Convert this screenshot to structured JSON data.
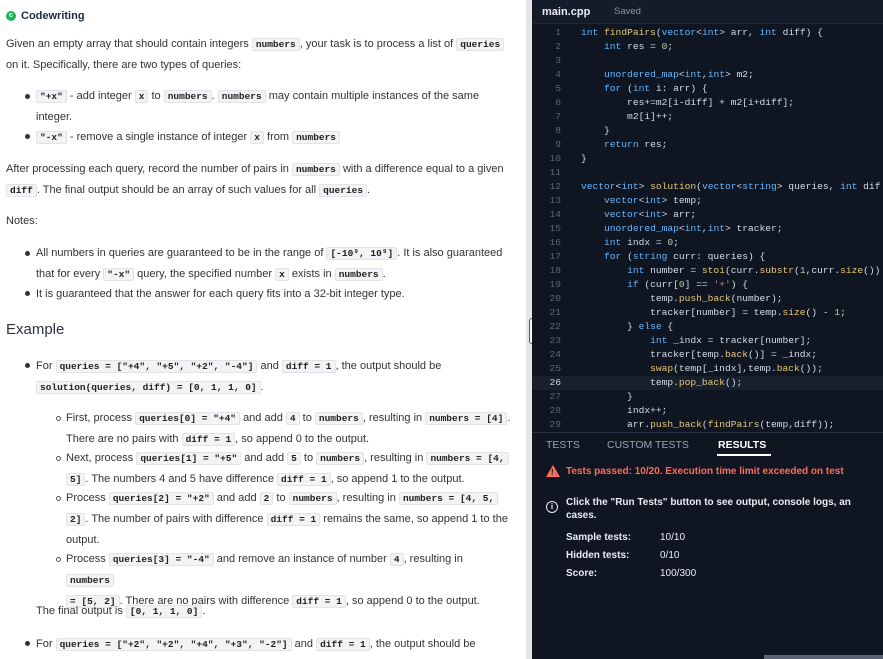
{
  "brand": {
    "name": "Codewriting",
    "icon": "codesignal-icon"
  },
  "problem": {
    "intro_1": "Given an empty array that should contain integers",
    "intro_numbers": "numbers",
    "intro_2": ", your task is to process a list of",
    "intro_queries": "queries",
    "intro_3": "on it. Specifically, there are two types of queries:",
    "q1_code": "\"+x\"",
    "q1_t1": "- add integer",
    "q1_x": "x",
    "q1_t2": "to",
    "q1_numbers": "numbers",
    "q1_t3": ".",
    "q1_numbers2": "numbers",
    "q1_t4": "may contain multiple instances of the same",
    "q1_t5": "integer.",
    "q2_code": "\"-x\"",
    "q2_t1": "- remove a single instance of integer",
    "q2_x": "x",
    "q2_t2": "from",
    "q2_numbers": "numbers",
    "after_1": "After processing each query, record the number of pairs in",
    "after_numbers": "numbers",
    "after_2": "with a difference equal to a given",
    "after_diff": "diff",
    "after_3": ". The final output should be an array of such values for all",
    "after_queries": "queries",
    "after_4": ".",
    "notes_label": "Notes",
    "notes_colon": ":",
    "note1_t1": "All numbers in queries are guaranteed to be in the range of",
    "note1_range": "[-10⁹, 10⁹]",
    "note1_t2": ". It is also guaranteed",
    "note1_t3": "that for every",
    "note1_code": "\"-x\"",
    "note1_t4": "query, the specified number",
    "note1_x": "x",
    "note1_t5": "exists in",
    "note1_numbers": "numbers",
    "note1_t6": ".",
    "note2": "It is guaranteed that the answer for each query fits into a 32-bit integer type.",
    "example_heading": "Example",
    "ex1_t1": "For",
    "ex1_queries": "queries = [\"+4\", \"+5\", \"+2\", \"-4\"]",
    "ex1_t2": "and",
    "ex1_diff": "diff = 1",
    "ex1_t3": ", the output should be",
    "ex1_solution": "solution(queries, diff) = [0, 1, 1, 0]",
    "ex1_t4": ".",
    "s1_t1": "First, process",
    "s1_q": "queries[0] = \"+4\"",
    "s1_t2": "and add",
    "s1_n": "4",
    "s1_t3": "to",
    "s1_numbers": "numbers",
    "s1_t4": ", resulting in",
    "s1_res": "numbers = [4]",
    "s1_t5": ".",
    "s1_t6": "There are no pairs with",
    "s1_diff": "diff = 1",
    "s1_t7": ", so append 0 to the output.",
    "s2_t1": "Next, process",
    "s2_q": "queries[1] = \"+5\"",
    "s2_t2": "and add",
    "s2_n": "5",
    "s2_t3": "to",
    "s2_numbers": "numbers",
    "s2_t4": ", resulting in",
    "s2_res_a": "numbers = [4,",
    "s2_res_b": "5]",
    "s2_t5": ". The numbers 4 and 5 have difference",
    "s2_diff": "diff = 1",
    "s2_t6": ", so append 1 to the output.",
    "s3_t1": "Process",
    "s3_q": "queries[2] = \"+2\"",
    "s3_t2": "and add",
    "s3_n": "2",
    "s3_t3": "to",
    "s3_numbers": "numbers",
    "s3_t4": ", resulting in",
    "s3_res_a": "numbers = [4, 5,",
    "s3_res_b": "2]",
    "s3_t5": ". The number of pairs with difference",
    "s3_diff": "diff = 1",
    "s3_t6": "remains the same, so append 1 to the",
    "s3_t7": "output.",
    "s4_t1": "Process",
    "s4_q": "queries[3] = \"-4\"",
    "s4_t2": "and remove an instance of number",
    "s4_n": "4",
    "s4_t3": ", resulting in",
    "s4_res_a": "numbers",
    "s4_res_b": "= [5, 2]",
    "s4_t4": ". There are no pairs with difference",
    "s4_diff": "diff = 1",
    "s4_t5": ", so append 0 to the output.",
    "final_t1": "The final output is",
    "final_code": "[0, 1, 1, 0]",
    "final_t2": ".",
    "ex2_t1": "For",
    "ex2_queries": "queries = [\"+2\", \"+2\", \"+4\", \"+3\", \"-2\"]",
    "ex2_t2": "and",
    "ex2_diff": "diff = 1",
    "ex2_t3": ", the output should be"
  },
  "editor": {
    "file_tab": "main.cpp",
    "saved_label": "Saved",
    "lines": [
      {
        "n": "1",
        "t": "int findPairs(vector<int> arr, int diff) {"
      },
      {
        "n": "2",
        "t": "    int res = 0;"
      },
      {
        "n": "3",
        "t": ""
      },
      {
        "n": "4",
        "t": "    unordered_map<int,int> m2;"
      },
      {
        "n": "5",
        "t": "    for (int i: arr) {"
      },
      {
        "n": "6",
        "t": "        res+=m2[i-diff] + m2[i+diff];"
      },
      {
        "n": "7",
        "t": "        m2[i]++;"
      },
      {
        "n": "8",
        "t": "    }"
      },
      {
        "n": "9",
        "t": "    return res;"
      },
      {
        "n": "10",
        "t": "}"
      },
      {
        "n": "11",
        "t": ""
      },
      {
        "n": "12",
        "t": "vector<int> solution(vector<string> queries, int dif"
      },
      {
        "n": "13",
        "t": "    vector<int> temp;"
      },
      {
        "n": "14",
        "t": "    vector<int> arr;"
      },
      {
        "n": "15",
        "t": "    unordered_map<int,int> tracker;"
      },
      {
        "n": "16",
        "t": "    int indx = 0;"
      },
      {
        "n": "17",
        "t": "    for (string curr: queries) {"
      },
      {
        "n": "18",
        "t": "        int number = stoi(curr.substr(1,curr.size())"
      },
      {
        "n": "19",
        "t": "        if (curr[0] == '+') {"
      },
      {
        "n": "20",
        "t": "            temp.push_back(number);"
      },
      {
        "n": "21",
        "t": "            tracker[number] = temp.size() - 1;"
      },
      {
        "n": "22",
        "t": "        } else {"
      },
      {
        "n": "23",
        "t": "            int _indx = tracker[number];"
      },
      {
        "n": "24",
        "t": "            tracker[temp.back()] = _indx;"
      },
      {
        "n": "25",
        "t": "            swap(temp[_indx],temp.back());"
      },
      {
        "n": "26",
        "t": "            temp.pop_back();"
      },
      {
        "n": "27",
        "t": "        }"
      },
      {
        "n": "28",
        "t": "        indx++;"
      },
      {
        "n": "29",
        "t": "        arr.push_back(findPairs(temp,diff));"
      }
    ],
    "active_line": 26
  },
  "results": {
    "tabs": [
      "TESTS",
      "CUSTOM TESTS",
      "RESULTS"
    ],
    "active_tab": "RESULTS",
    "warning": "Tests passed: 10/20. Execution time limit exceeded on test",
    "info": "Click the \"Run Tests\" button to see output, console logs, an cases.",
    "info_a": "Click the \"Run Tests\" button to see output, console logs, an",
    "info_b": "cases.",
    "stats": [
      {
        "label": "Sample tests:",
        "value": "10/10"
      },
      {
        "label": "Hidden tests:",
        "value": "0/10"
      },
      {
        "label": "Score:",
        "value": "100/300"
      }
    ]
  },
  "colors": {
    "accent_green": "#1cb55a",
    "error_red": "#ff6b5c",
    "editor_bg": "#0f1521"
  }
}
